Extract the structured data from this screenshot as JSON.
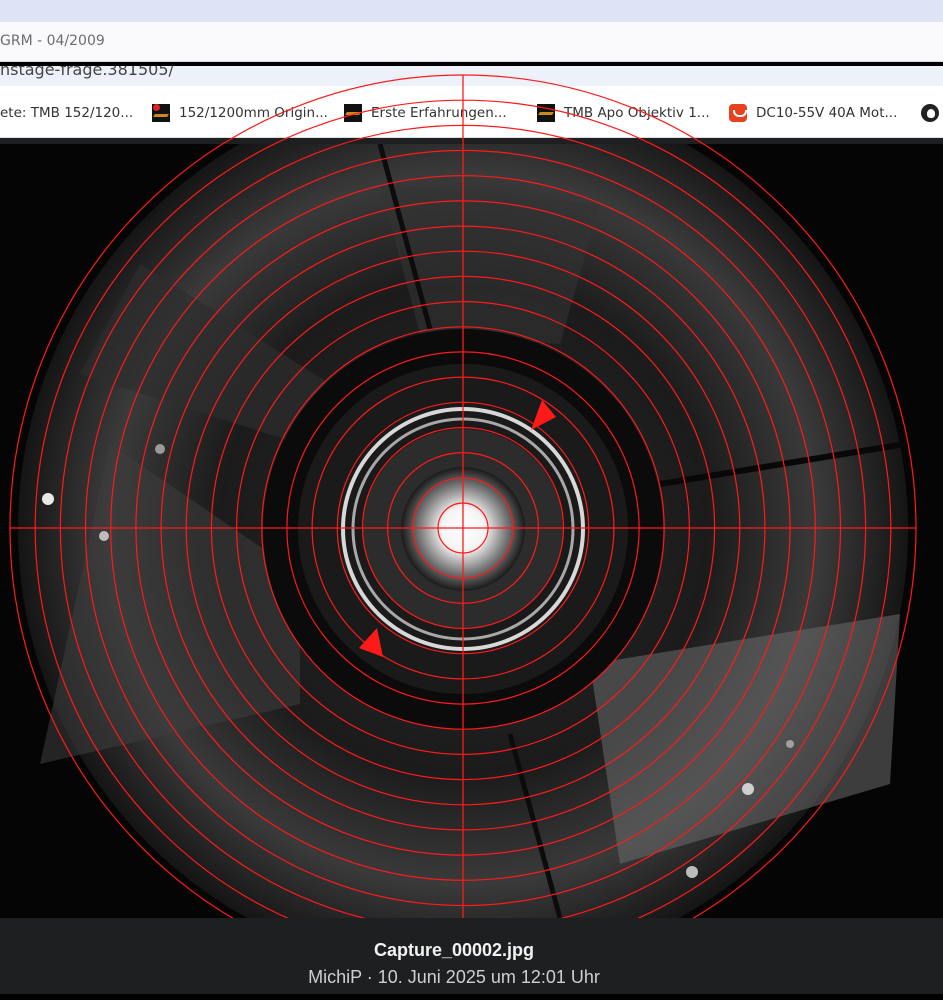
{
  "window": {
    "title": "GRM - 04/2009",
    "url_fragment": "nstage-frage.381505/"
  },
  "bookmarks": [
    {
      "label": "ete: TMB 152/120...",
      "icon": "none"
    },
    {
      "label": "152/1200mm Origin...",
      "icon": "tmb-red-dot-icon"
    },
    {
      "label": "Erste Erfahrungen...",
      "icon": "tmb-logo-icon"
    },
    {
      "label": "TMB Apo Objektiv 1...",
      "icon": "tmb-logo-icon"
    },
    {
      "label": "DC10-55V 40A Mot...",
      "icon": "aliexpress-icon"
    },
    {
      "label": "",
      "icon": "github-icon"
    }
  ],
  "image_viewer": {
    "filename": "Capture_00002.jpg",
    "meta": "MichiP · 10. Juni 2025 um 12:01 Uhr",
    "overlay": {
      "type": "concentric-ring-reticle",
      "color": "#ff1a1a",
      "ring_count": 18,
      "crosshair": true,
      "markers": "two red triangle markers"
    }
  }
}
